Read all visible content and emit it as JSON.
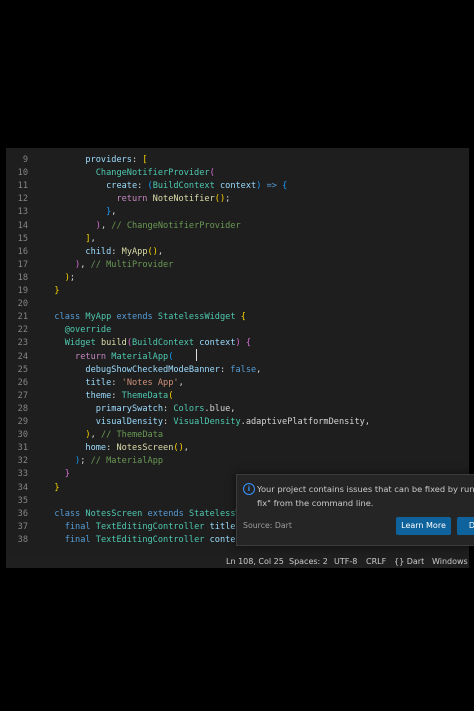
{
  "editor": {
    "lines": [
      {
        "n": "9",
        "segs": [
          [
            "",
            "        "
          ],
          [
            "pr",
            "providers"
          ],
          [
            "",
            ": "
          ],
          [
            "pn",
            "["
          ]
        ]
      },
      {
        "n": "10",
        "segs": [
          [
            "",
            "          "
          ],
          [
            "ty",
            "ChangeNotifierProvider"
          ],
          [
            "pn2",
            "("
          ]
        ]
      },
      {
        "n": "11",
        "segs": [
          [
            "",
            "            "
          ],
          [
            "pr",
            "create"
          ],
          [
            "",
            ": "
          ],
          [
            "pn3",
            "("
          ],
          [
            "ty",
            "BuildContext"
          ],
          [
            "",
            " "
          ],
          [
            "pr",
            "context"
          ],
          [
            "pn3",
            ")"
          ],
          [
            "",
            " "
          ],
          [
            "kw",
            "=>"
          ],
          [
            "",
            " "
          ],
          [
            "pn3",
            "{"
          ]
        ]
      },
      {
        "n": "12",
        "segs": [
          [
            "",
            "              "
          ],
          [
            "kw2",
            "return"
          ],
          [
            "",
            " "
          ],
          [
            "fn",
            "NoteNotifier"
          ],
          [
            "pn",
            "()"
          ],
          [
            "",
            ";"
          ]
        ]
      },
      {
        "n": "13",
        "segs": [
          [
            "",
            "            "
          ],
          [
            "pn3",
            "}"
          ],
          [
            "",
            ","
          ]
        ]
      },
      {
        "n": "14",
        "segs": [
          [
            "",
            "          "
          ],
          [
            "pn2",
            ")"
          ],
          [
            "",
            ", "
          ],
          [
            "cm",
            "// ChangeNotifierProvider"
          ]
        ]
      },
      {
        "n": "15",
        "segs": [
          [
            "",
            "        "
          ],
          [
            "pn",
            "]"
          ],
          [
            "",
            ","
          ]
        ]
      },
      {
        "n": "16",
        "segs": [
          [
            "",
            "        "
          ],
          [
            "pr",
            "child"
          ],
          [
            "",
            ": "
          ],
          [
            "fn",
            "MyApp"
          ],
          [
            "pn",
            "()"
          ],
          [
            "",
            ","
          ]
        ]
      },
      {
        "n": "17",
        "segs": [
          [
            "",
            "      "
          ],
          [
            "pn2",
            ")"
          ],
          [
            "",
            ", "
          ],
          [
            "cm",
            "// MultiProvider"
          ]
        ]
      },
      {
        "n": "18",
        "segs": [
          [
            "",
            "    "
          ],
          [
            "pn",
            ")"
          ],
          [
            "",
            ";"
          ]
        ]
      },
      {
        "n": "19",
        "segs": [
          [
            "",
            "  "
          ],
          [
            "pn",
            "}"
          ]
        ]
      },
      {
        "n": "20",
        "segs": []
      },
      {
        "n": "21",
        "segs": [
          [
            "",
            "  "
          ],
          [
            "kw",
            "class"
          ],
          [
            "",
            " "
          ],
          [
            "ty",
            "MyApp"
          ],
          [
            "",
            " "
          ],
          [
            "kw",
            "extends"
          ],
          [
            "",
            " "
          ],
          [
            "ty",
            "StatelessWidget"
          ],
          [
            "",
            " "
          ],
          [
            "pn",
            "{"
          ]
        ]
      },
      {
        "n": "22",
        "segs": [
          [
            "",
            "    "
          ],
          [
            "ty",
            "@override"
          ]
        ]
      },
      {
        "n": "23",
        "segs": [
          [
            "",
            "    "
          ],
          [
            "ty",
            "Widget"
          ],
          [
            "",
            " "
          ],
          [
            "fn",
            "build"
          ],
          [
            "pn2",
            "("
          ],
          [
            "ty",
            "BuildContext"
          ],
          [
            "",
            " "
          ],
          [
            "pr",
            "context"
          ],
          [
            "pn2",
            ")"
          ],
          [
            "",
            " "
          ],
          [
            "pn2",
            "{"
          ]
        ]
      },
      {
        "n": "24",
        "segs": [
          [
            "",
            "      "
          ],
          [
            "kw2",
            "return"
          ],
          [
            "",
            " "
          ],
          [
            "ty",
            "MaterialApp"
          ],
          [
            "pn3",
            "("
          ]
        ]
      },
      {
        "n": "25",
        "segs": [
          [
            "",
            "        "
          ],
          [
            "pr",
            "debugShowCheckedModeBanner"
          ],
          [
            "",
            ": "
          ],
          [
            "kw",
            "false"
          ],
          [
            "",
            ","
          ]
        ]
      },
      {
        "n": "26",
        "segs": [
          [
            "",
            "        "
          ],
          [
            "pr",
            "title"
          ],
          [
            "",
            ": "
          ],
          [
            "st",
            "'Notes App'"
          ],
          [
            "",
            ","
          ]
        ]
      },
      {
        "n": "27",
        "segs": [
          [
            "",
            "        "
          ],
          [
            "pr",
            "theme"
          ],
          [
            "",
            ": "
          ],
          [
            "ty",
            "ThemeData"
          ],
          [
            "pn",
            "("
          ]
        ]
      },
      {
        "n": "28",
        "segs": [
          [
            "",
            "          "
          ],
          [
            "pr",
            "primarySwatch"
          ],
          [
            "",
            ": "
          ],
          [
            "ty",
            "Colors"
          ],
          [
            "",
            ".blue,"
          ]
        ]
      },
      {
        "n": "29",
        "segs": [
          [
            "",
            "          "
          ],
          [
            "pr",
            "visualDensity"
          ],
          [
            "",
            ": "
          ],
          [
            "ty",
            "VisualDensity"
          ],
          [
            "",
            ".adaptivePlatformDensity,"
          ]
        ]
      },
      {
        "n": "30",
        "segs": [
          [
            "",
            "        "
          ],
          [
            "pn",
            ")"
          ],
          [
            "",
            ", "
          ],
          [
            "cm",
            "// ThemeData"
          ]
        ]
      },
      {
        "n": "31",
        "segs": [
          [
            "",
            "        "
          ],
          [
            "pr",
            "home"
          ],
          [
            "",
            ": "
          ],
          [
            "fn",
            "NotesScreen"
          ],
          [
            "pn",
            "()"
          ],
          [
            "",
            ","
          ]
        ]
      },
      {
        "n": "32",
        "segs": [
          [
            "",
            "      "
          ],
          [
            "pn3",
            ")"
          ],
          [
            "",
            ";"
          ],
          [
            "",
            " "
          ],
          [
            "cm",
            "// MaterialApp"
          ]
        ]
      },
      {
        "n": "33",
        "segs": [
          [
            "",
            "    "
          ],
          [
            "pn2",
            "}"
          ]
        ]
      },
      {
        "n": "34",
        "segs": [
          [
            "",
            "  "
          ],
          [
            "pn",
            "}"
          ]
        ]
      },
      {
        "n": "35",
        "segs": []
      },
      {
        "n": "36",
        "segs": [
          [
            "",
            "  "
          ],
          [
            "kw",
            "class"
          ],
          [
            "",
            " "
          ],
          [
            "ty",
            "NotesScreen"
          ],
          [
            "",
            " "
          ],
          [
            "kw",
            "extends"
          ],
          [
            "",
            " "
          ],
          [
            "ty",
            "StatelessW"
          ]
        ]
      },
      {
        "n": "37",
        "segs": [
          [
            "",
            "    "
          ],
          [
            "kw",
            "final"
          ],
          [
            "",
            " "
          ],
          [
            "ty",
            "TextEditingController"
          ],
          [
            "",
            " "
          ],
          [
            "pr",
            "titleC"
          ]
        ]
      },
      {
        "n": "38",
        "segs": [
          [
            "",
            "    "
          ],
          [
            "kw",
            "final"
          ],
          [
            "",
            " "
          ],
          [
            "ty",
            "TextEditingController"
          ],
          [
            "",
            " "
          ],
          [
            "pr",
            "conten"
          ]
        ]
      }
    ]
  },
  "status_bar": {
    "position": "Ln 108, Col 25",
    "spaces": "Spaces: 2",
    "encoding": "UTF-8",
    "eol": "CRLF",
    "language": "{} Dart",
    "os": "Windows"
  },
  "notification": {
    "icon": "info-icon",
    "message_line1": "Your project contains issues that can be fixed by runni",
    "message_line2": "fix\" from the command line.",
    "source": "Source: Dart",
    "learn_more": "Learn More",
    "second_button": "D"
  }
}
